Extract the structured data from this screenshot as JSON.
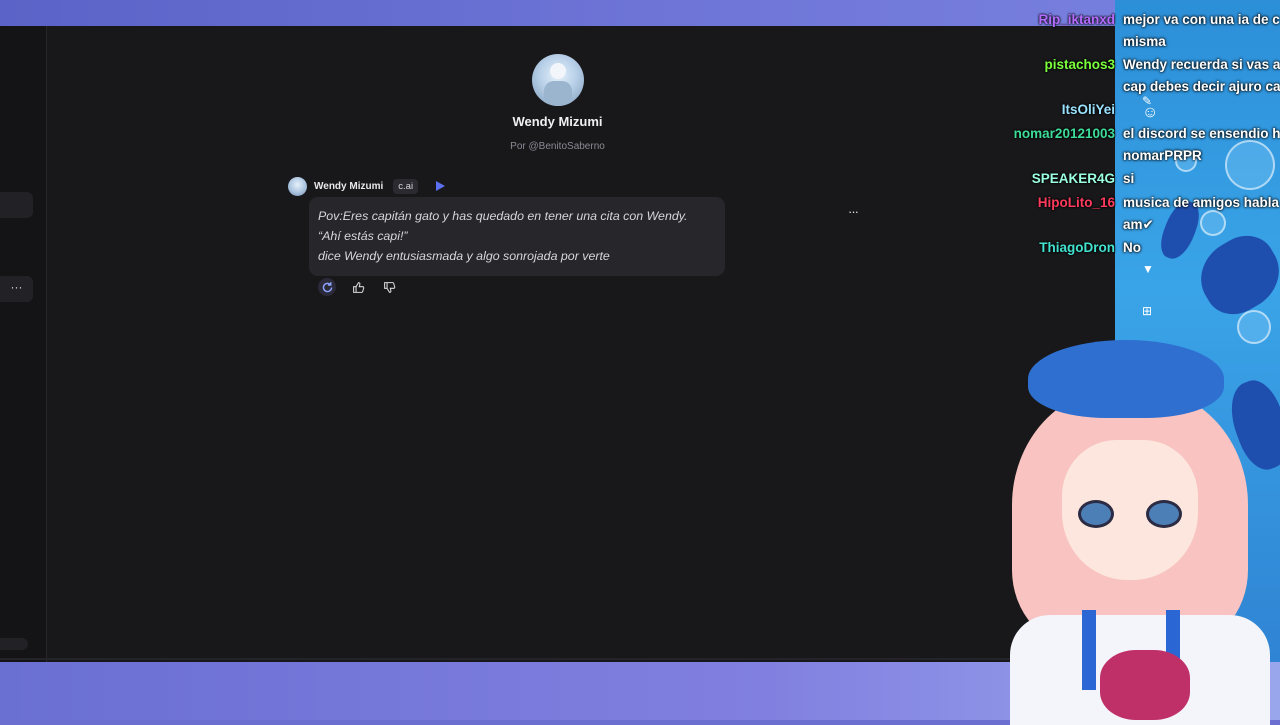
{
  "character": {
    "name": "Wendy Mizumi",
    "author": "Por @BenitoSaberno"
  },
  "message": {
    "author": "Wendy Mizumi",
    "badge": "c.ai",
    "lines": [
      "Pov:Eres capitán gato y has quedado en tener una cita con Wendy.",
      "“Ahí estás capi!”",
      "dice Wendy entusiasmada y algo sonrojada por verte"
    ],
    "more": "···"
  },
  "sidebar": {
    "more": "···"
  },
  "colors": {
    "accent": "#5b6ff0",
    "app_bg": "#18181b",
    "bubble_bg": "#26262b"
  },
  "stream_chat": [
    {
      "user": "Rip_iktanxd",
      "color": "#b56cff",
      "text": "mejor va con una ia de c"
    },
    {
      "user": "",
      "color": "#ffffff",
      "text": "misma"
    },
    {
      "user": "pistachos3",
      "color": "#7cff3c",
      "text": "Wendy recuerda si vas a"
    },
    {
      "user": "",
      "color": "#ffffff",
      "text": "cap debes decir ajuro ca"
    },
    {
      "user": "ItsOliYei",
      "color": "#9be2ff",
      "text": ""
    },
    {
      "user": "nomar20121003",
      "color": "#3ddc98",
      "text": "el discord se ensendio h"
    },
    {
      "user": "",
      "color": "#ffffff",
      "text": "nomarPRPR"
    },
    {
      "user": "SPEAKER4G",
      "color": "#9bffe0",
      "text": "si"
    },
    {
      "user": "HipoLito_16",
      "color": "#ff3a5c",
      "text": "musica de amigos habla"
    },
    {
      "user": "",
      "color": "#ffffff",
      "text": "am✔"
    },
    {
      "user": "ThiagoDron",
      "color": "#42e2d0",
      "text": "No"
    }
  ]
}
